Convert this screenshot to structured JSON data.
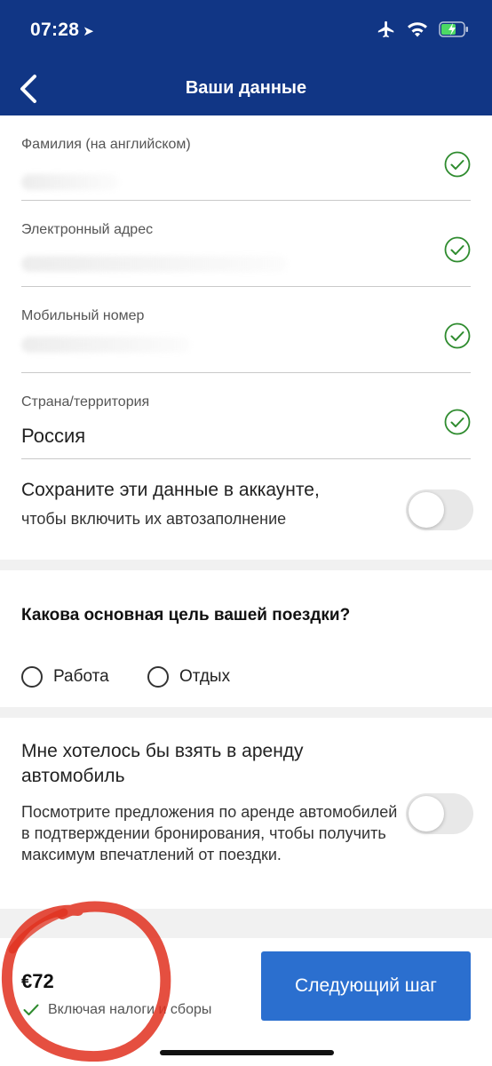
{
  "status_bar": {
    "time": "07:28"
  },
  "nav": {
    "title": "Ваши данные"
  },
  "fields": [
    {
      "label": "Фамилия (на английском)",
      "value": ""
    },
    {
      "label": "Электронный адрес",
      "value": ""
    },
    {
      "label": "Мобильный номер",
      "value": ""
    },
    {
      "label": "Страна/территория",
      "value": "Россия"
    }
  ],
  "save_account": {
    "line1": "Сохраните эти данные в аккаунте,",
    "line2": "чтобы включить их автозаполнение",
    "enabled": false
  },
  "purpose": {
    "question": "Какова основная цель вашей поездки?",
    "options": [
      "Работа",
      "Отдых"
    ]
  },
  "car_rental": {
    "title": "Мне хотелось бы взять в аренду автомобиль",
    "description": "Посмотрите предложения по аренде автомобилей в подтверждении бронирования, чтобы получить максимум впечатлений от поездки.",
    "enabled": false
  },
  "footer": {
    "price": "€72",
    "taxes_note": "Включая налоги и сборы",
    "next_button": "Следующий шаг"
  },
  "colors": {
    "header_bg": "#113685",
    "primary_button": "#2b6fcf",
    "check_green": "#2e8b2e",
    "annotation_red": "#e0301e"
  }
}
